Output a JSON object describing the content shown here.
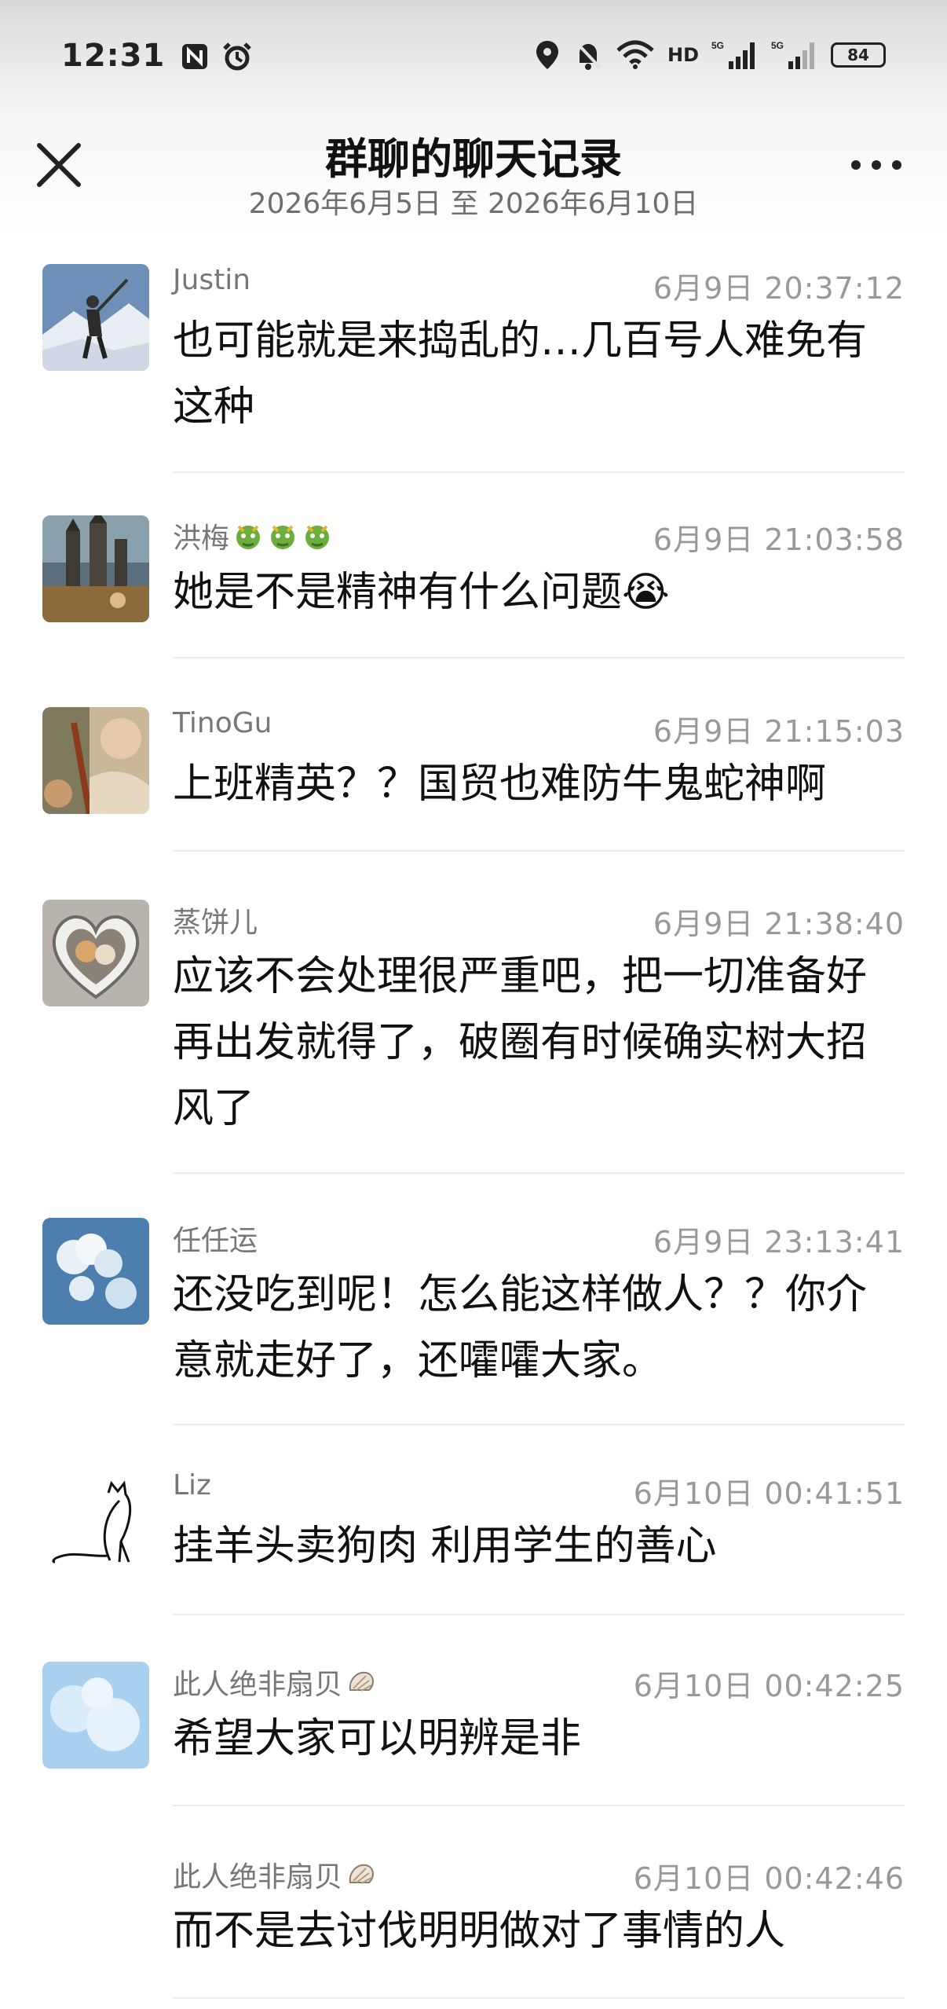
{
  "status_bar": {
    "time": "12:31",
    "network_labels": [
      "HD",
      "5G",
      "5G"
    ],
    "battery": "84"
  },
  "header": {
    "title": "群聊的聊天记录",
    "date_range": "2026年6月5日 至 2026年6月10日"
  },
  "messages": [
    {
      "name": "Justin",
      "time": "6月9日 20:37:12",
      "text": "也可能就是来捣乱的…几百号人难免有这种",
      "avatar": "mountain-climber"
    },
    {
      "name": "洪梅",
      "name_emoji": "dragon-face x3",
      "time": "6月9日 21:03:58",
      "text": "她是不是精神有什么问题😭",
      "avatar": "castle"
    },
    {
      "name": "TinoGu",
      "time": "6月9日 21:15:03",
      "text": "上班精英？？国贸也难防牛鬼蛇神啊",
      "avatar": "person-photo"
    },
    {
      "name": "蒸饼儿",
      "time": "6月9日 21:38:40",
      "text": "应该不会处理很严重吧，把一切准备好再出发就得了，破圈有时候确实树大招风了",
      "avatar": "cat-heart-frame"
    },
    {
      "name": "任任运",
      "time": "6月9日 23:13:41",
      "text": "还没吃到呢！怎么能这样做人？？你介意就走好了，还嚯嚯大家。",
      "avatar": "clouds"
    },
    {
      "name": "Liz",
      "time": "6月10日 00:41:51",
      "text": "挂羊头卖狗肉 利用学生的善心",
      "avatar": "cat-sketch"
    },
    {
      "name": "此人绝非扇贝",
      "name_emoji": "shell",
      "time": "6月10日 00:42:25",
      "text": "希望大家可以明辨是非",
      "avatar": "sky"
    },
    {
      "name": "此人绝非扇贝",
      "name_emoji": "shell",
      "time": "6月10日 00:42:46",
      "text": "而不是去讨伐明明做对了事情的人",
      "avatar": "none"
    }
  ]
}
